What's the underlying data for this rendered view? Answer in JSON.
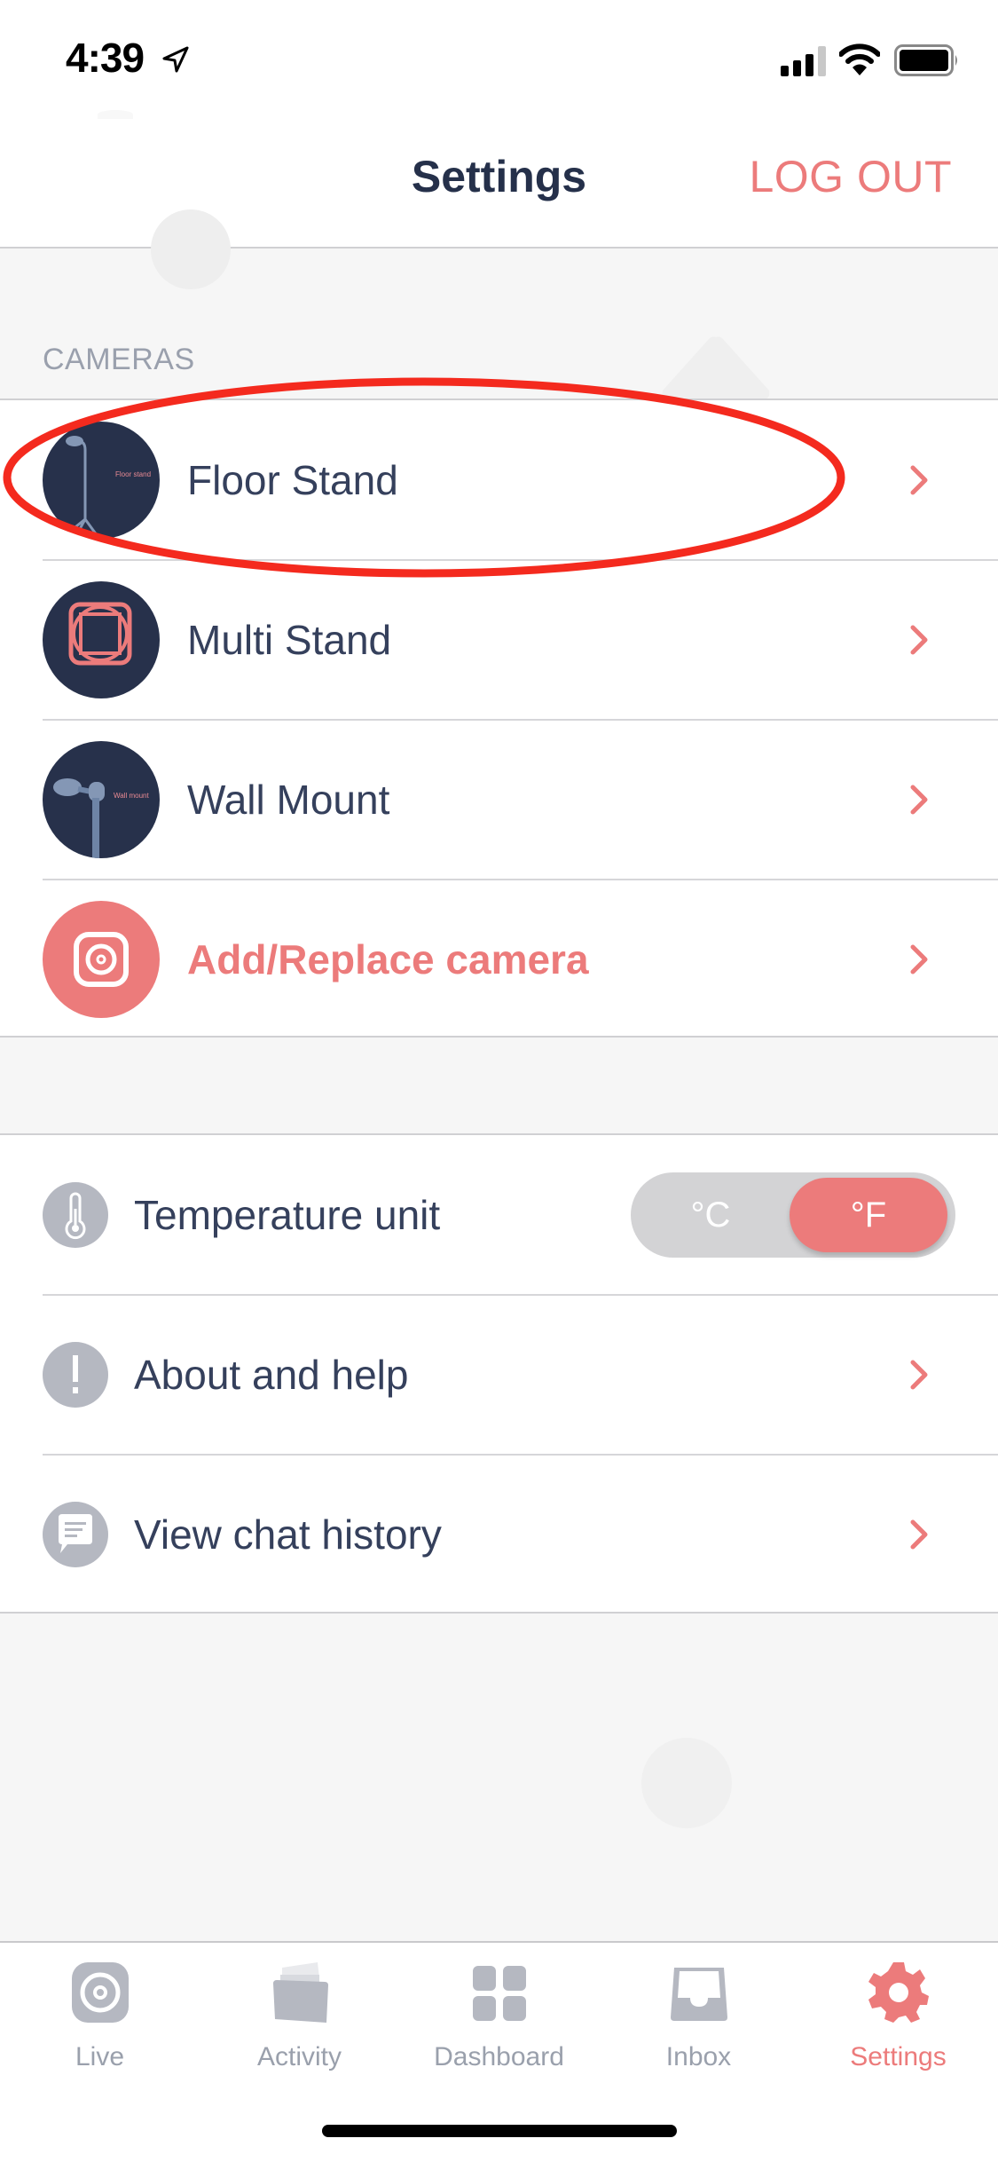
{
  "status_bar": {
    "time": "4:39",
    "icons": [
      "location-arrow-icon",
      "cellular-signal-icon",
      "wifi-icon",
      "battery-icon"
    ]
  },
  "header": {
    "title": "Settings",
    "logout_label": "LOG OUT"
  },
  "cameras": {
    "section_label": "CAMERAS",
    "items": [
      {
        "label": "Floor Stand",
        "thumbnail_caption": "Floor stand",
        "icon": "floor-stand-thumbnail"
      },
      {
        "label": "Multi Stand",
        "icon": "multi-stand-thumbnail"
      },
      {
        "label": "Wall Mount",
        "thumbnail_caption": "Wall mount",
        "icon": "wall-mount-thumbnail"
      },
      {
        "label": "Add/Replace camera",
        "icon": "camera-icon",
        "accent": true
      }
    ]
  },
  "settings": {
    "items": [
      {
        "label": "Temperature unit",
        "icon": "thermometer-icon"
      },
      {
        "label": "About and help",
        "icon": "exclamation-icon"
      },
      {
        "label": "View chat history",
        "icon": "chat-bubble-icon"
      }
    ],
    "temperature_toggle": {
      "options": [
        "°C",
        "°F"
      ],
      "selected": "°F"
    }
  },
  "tab_bar": {
    "tabs": [
      {
        "label": "Live",
        "icon": "live-camera-icon",
        "active": false
      },
      {
        "label": "Activity",
        "icon": "activity-cards-icon",
        "active": false
      },
      {
        "label": "Dashboard",
        "icon": "dashboard-grid-icon",
        "active": false
      },
      {
        "label": "Inbox",
        "icon": "inbox-tray-icon",
        "active": false
      },
      {
        "label": "Settings",
        "icon": "gear-icon",
        "active": true
      }
    ]
  },
  "annotation": {
    "type": "red-ellipse",
    "target": "Floor Stand"
  },
  "colors": {
    "accent": "#ec7b7b",
    "navy": "#27314b",
    "text": "#35405c",
    "icon_gray": "#b5b8c1",
    "background": "#f6f6f6"
  }
}
